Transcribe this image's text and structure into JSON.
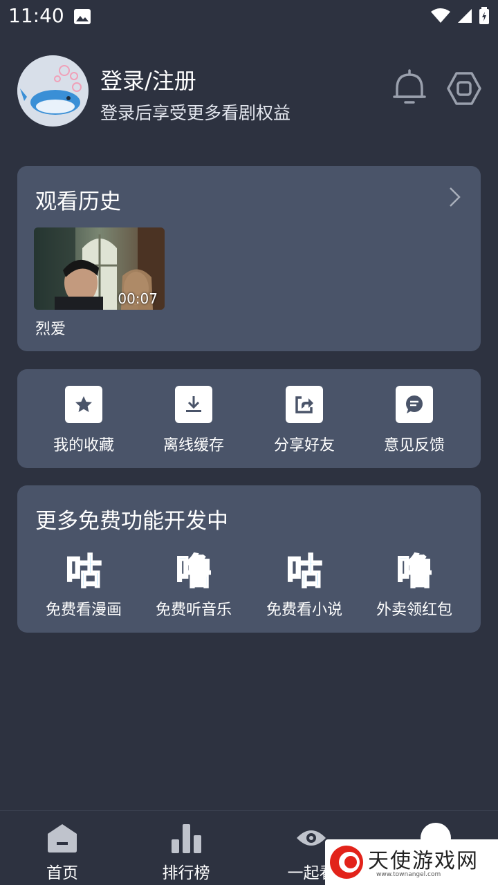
{
  "status_bar": {
    "time": "11:40",
    "icons": [
      "image-icon",
      "wifi-icon",
      "signal-icon",
      "battery-icon"
    ]
  },
  "profile": {
    "title": "登录/注册",
    "subtitle": "登录后享受更多看剧权益",
    "icons": [
      "bell-icon",
      "settings-icon"
    ]
  },
  "history": {
    "title": "观看历史",
    "items": [
      {
        "name": "烈爱",
        "duration": "00:07"
      }
    ]
  },
  "actions": [
    {
      "label": "我的收藏",
      "icon": "star-icon"
    },
    {
      "label": "离线缓存",
      "icon": "download-icon"
    },
    {
      "label": "分享好友",
      "icon": "share-icon"
    },
    {
      "label": "意见反馈",
      "icon": "feedback-icon"
    }
  ],
  "more": {
    "title": "更多免费功能开发中",
    "items": [
      {
        "glyph": "咕",
        "label": "免费看漫画"
      },
      {
        "glyph": "噜",
        "label": "免费听音乐"
      },
      {
        "glyph": "咕",
        "label": "免费看小说"
      },
      {
        "glyph": "噜",
        "label": "外卖领红包"
      }
    ]
  },
  "bottom_nav": [
    {
      "label": "首页",
      "icon": "home-icon"
    },
    {
      "label": "排行榜",
      "icon": "ranking-icon"
    },
    {
      "label": "一起看",
      "icon": "eye-icon"
    },
    {
      "label": "",
      "icon": "profile-icon"
    }
  ],
  "watermark": {
    "text": "天使游戏网",
    "url": "www.townangel.com"
  },
  "colors": {
    "background": "#2d3240",
    "card": "#4a5469",
    "accent_glyph": "#29a8f0"
  }
}
